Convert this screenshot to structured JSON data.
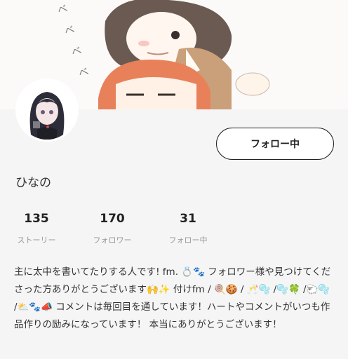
{
  "header": {
    "artwork": "cover-illustration",
    "doodle_text": [
      "べ",
      "べ",
      "べ",
      "べ"
    ]
  },
  "profile": {
    "avatar": "avatar-illustration",
    "username": "ひなの",
    "follow_button_label": "フォロー中"
  },
  "stats": [
    {
      "value": "135",
      "label": "ストーリー"
    },
    {
      "value": "170",
      "label": "フォロワー"
    },
    {
      "value": "31",
      "label": "フォロー中"
    }
  ],
  "bio": "主に太中を書いてたりする人です! fm. 💍🐾 フォロワー様や見つけてくださった方ありがとうございます🙌✨ 付けfm / 🍭🍪 / 🥂🫧 /🫧🍀 /🐑🫧 /⛅🐾📣 コメントは毎回目を通しています！ハートやコメントがいつも作品作りの励みになっています！ 本当にありがとうございます！"
}
